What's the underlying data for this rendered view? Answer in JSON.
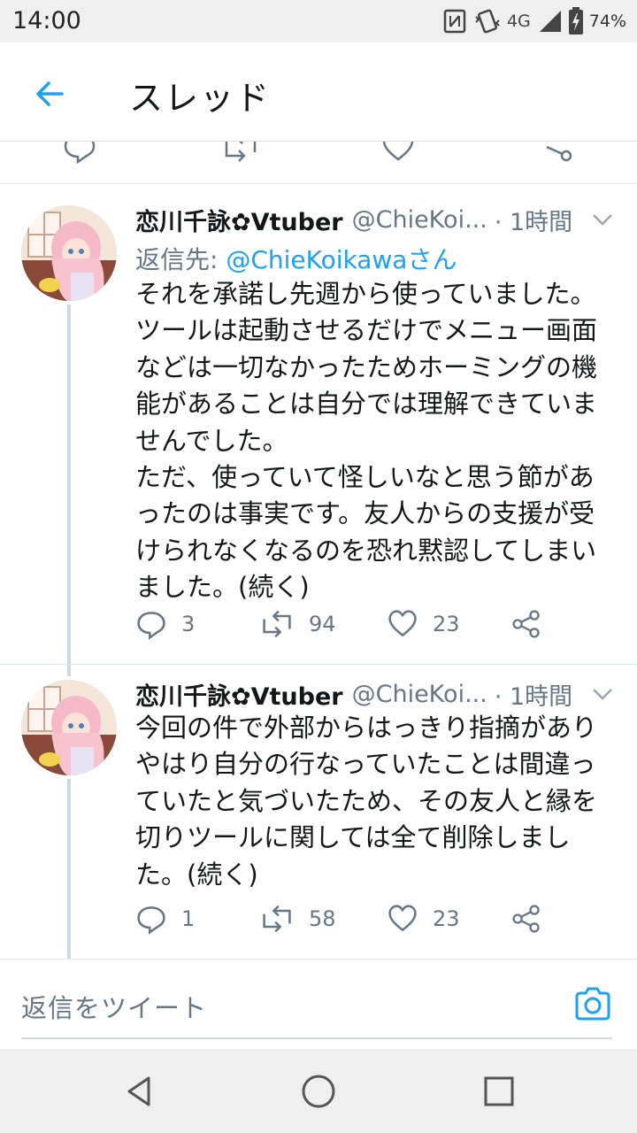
{
  "status_bar": {
    "time": "14:00",
    "network": "4G",
    "battery": "74%",
    "icons": [
      "nfc-icon",
      "vibrate-icon",
      "signal-icon",
      "battery-charging-icon"
    ]
  },
  "header": {
    "title": "スレッド",
    "back_icon": "arrow-left-icon"
  },
  "tweets": [
    {
      "name": "恋川千詠✿Vtuber",
      "handle": "@ChieKoi...",
      "time": "· 1時間",
      "reply_prefix": "返信先: ",
      "reply_mention": "@ChieKoikawaさん",
      "lines": [
        "それを承諾し先週から使っていました。",
        "ツールは起動させるだけでメニュー画面",
        "などは一切なかったためホーミングの機",
        "能があることは自分では理解できていま",
        "せんでした。",
        "ただ、使っていて怪しいなと思う節があ",
        "ったのは事実です。友人からの支援が受",
        "けられなくなるのを恐れ黙認してしまい",
        "ました。(続く)"
      ],
      "replies": "3",
      "retweets": "94",
      "likes": "23"
    },
    {
      "name": "恋川千詠✿Vtuber",
      "handle": "@ChieKoi...",
      "time": "· 1時間",
      "lines": [
        "今回の件で外部からはっきり指摘があり",
        "やはり自分の行なっていたことは間違っ",
        "ていたと気づいたため、その友人と縁を",
        "切りツールに関しては全て削除しまし",
        "た。(続く)"
      ],
      "replies": "1",
      "retweets": "58",
      "likes": "23"
    }
  ],
  "composer": {
    "placeholder": "返信をツイート",
    "icon": "camera-icon"
  },
  "navbar": {
    "icons": [
      "back-triangle-icon",
      "home-circle-icon",
      "recents-square-icon"
    ]
  },
  "colors": {
    "accent": "#1da1f2",
    "secondary_text": "#657786",
    "text": "#14171a",
    "system_bar": "#efefef"
  }
}
